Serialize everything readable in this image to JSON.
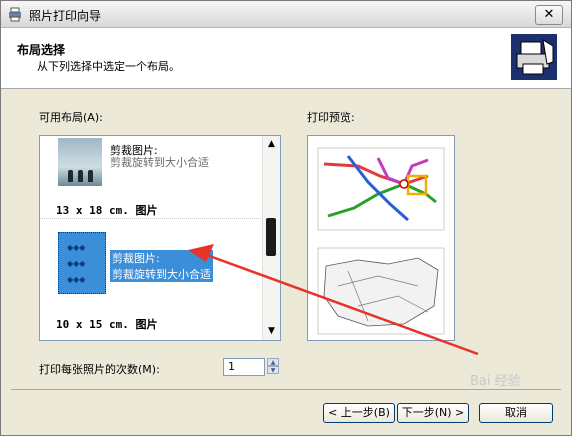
{
  "window": {
    "title": "照片打印向导",
    "close_label": "✕"
  },
  "header": {
    "title": "布局选择",
    "subtitle": "从下列选择中选定一个布局。"
  },
  "layouts": {
    "label": "可用布局(A):",
    "items": [
      {
        "title": "剪裁图片:",
        "description": "剪裁旋转到大小合适",
        "size": "13 x 18 cm. 图片",
        "selected": false
      },
      {
        "title": "剪裁图片:",
        "description": "剪裁旋转到大小合适",
        "size": "10 x 15 cm. 图片",
        "selected": true
      }
    ]
  },
  "preview": {
    "label": "打印预览:"
  },
  "copies": {
    "label": "打印每张照片的次数(M):",
    "value": "1"
  },
  "buttons": {
    "back": "< 上一步(B)",
    "next": "下一步(N) >",
    "cancel": "取消"
  },
  "watermark": "Bai 经验",
  "colors": {
    "selection": "#3b8fd9",
    "annotation_arrow": "#e8332a",
    "dialog_bg": "#ece9d8"
  }
}
